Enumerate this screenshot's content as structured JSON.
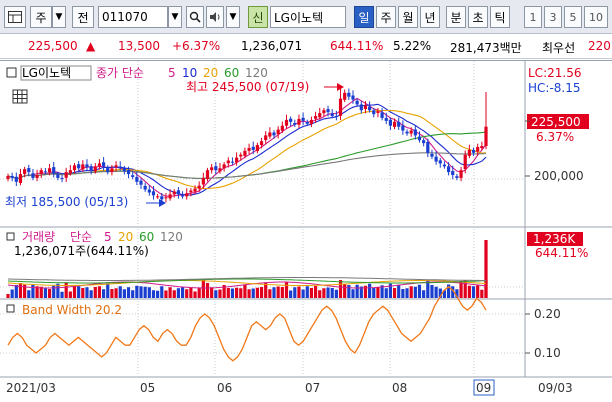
{
  "toolbar": {
    "mode_label": "주",
    "prev_label": "전",
    "code": "011070",
    "new_label": "신",
    "stock_name": "LG이노텍",
    "periods": [
      "일",
      "주",
      "월",
      "년",
      "분",
      "초",
      "틱"
    ],
    "active_period": "일",
    "intervals": [
      "1",
      "3",
      "5",
      "10"
    ]
  },
  "quote": {
    "price": "225,500",
    "change": "13,500",
    "change_pct": "+6.37%",
    "volume": "1,236,071",
    "vol_ratio": "644.11%",
    "turnover": "5.22%",
    "amount": "281,473백만",
    "best_ask_label": "최우선",
    "best_ask_value": "220"
  },
  "price_panel": {
    "name": "LG이노텍",
    "ma_label": "종가 단순",
    "ma_periods": [
      "5",
      "10",
      "20",
      "60",
      "120"
    ],
    "ma_colors": [
      "#d01c8b",
      "#1c2bd0",
      "#e8a300",
      "#2a9a2a",
      "#7a7a7a"
    ],
    "high_annotation": "최고 245,500 (07/19)",
    "low_annotation": "최저 185,500 (05/13)",
    "lc_label": "LC:21.56",
    "hc_label": "HC:-8.15",
    "price_badge": "225,500",
    "price_pct": "6.37%",
    "y_tick_label": "200,000"
  },
  "volume_panel": {
    "label": "거래량",
    "ma_label": "단순",
    "ma_periods": [
      "5",
      "20",
      "60",
      "120"
    ],
    "ma_colors": [
      "#d01c8b",
      "#e8a300",
      "#2a9a2a",
      "#7a7a7a"
    ],
    "detail": "1,236,071주(644.11%)",
    "badge": "1,236K",
    "badge_pct": "644.11%"
  },
  "bw_panel": {
    "label": "Band Width 20.2",
    "ticks": [
      "0.20",
      "0.10"
    ]
  },
  "x_axis": {
    "labels": [
      "2021/03",
      "05",
      "06",
      "07",
      "08",
      "09"
    ],
    "right_label": "09/03"
  },
  "colors": {
    "up": "#e1001e",
    "down": "#1a3fd0",
    "bandwidth": "#f07818",
    "highlight": "#2a5fc4"
  },
  "chart_data": {
    "type": "candlestick",
    "price_series": {
      "name": "LG이노텍",
      "x_labels": [
        "2021/03",
        "05",
        "06",
        "07",
        "08",
        "09"
      ],
      "close": [
        200000,
        199000,
        197000,
        201000,
        203500,
        202000,
        199000,
        200500,
        203000,
        202000,
        204000,
        201500,
        199000,
        198500,
        202000,
        203000,
        205500,
        204000,
        206000,
        204500,
        203000,
        205000,
        206500,
        205000,
        202000,
        204000,
        205500,
        204000,
        202500,
        201000,
        199500,
        197000,
        195500,
        193000,
        191500,
        190000,
        189500,
        188000,
        189000,
        190500,
        192000,
        190500,
        189500,
        191000,
        192500,
        193500,
        195000,
        199000,
        203000,
        204500,
        203000,
        204000,
        206000,
        208000,
        207000,
        209500,
        211000,
        213000,
        214500,
        213500,
        216000,
        218000,
        221000,
        222500,
        221000,
        224000,
        226000,
        229000,
        228000,
        226500,
        229500,
        228500,
        227000,
        229000,
        231000,
        232500,
        234000,
        233000,
        231000,
        230500,
        240000,
        243000,
        241000,
        239500,
        237000,
        234000,
        236500,
        234000,
        232000,
        233500,
        230000,
        228500,
        226000,
        228000,
        225500,
        223500,
        222000,
        223500,
        221000,
        218500,
        217000,
        212000,
        210000,
        207500,
        206500,
        205000,
        202000,
        200500,
        199000,
        203000,
        211000,
        213500,
        212000,
        215000,
        215500,
        225500
      ],
      "high_point": {
        "label": "최고 245,500 (07/19)",
        "value": 245500
      },
      "low_point": {
        "label": "최저 185,500 (05/13)",
        "value": 185500
      }
    },
    "volume_series": {
      "name": "거래량",
      "last_value": 1236071,
      "last_ratio": "644.11%"
    },
    "bandwidth_series": {
      "name": "Band Width 20.2",
      "values": [
        0.12,
        0.14,
        0.15,
        0.14,
        0.12,
        0.11,
        0.1,
        0.11,
        0.12,
        0.14,
        0.15,
        0.14,
        0.13,
        0.12,
        0.13,
        0.14,
        0.13,
        0.12,
        0.11,
        0.1,
        0.09,
        0.1,
        0.12,
        0.14,
        0.13,
        0.12,
        0.12,
        0.14,
        0.16,
        0.17,
        0.16,
        0.14,
        0.13,
        0.15,
        0.16,
        0.15,
        0.13,
        0.12,
        0.12,
        0.14,
        0.17,
        0.19,
        0.2,
        0.19,
        0.17,
        0.14,
        0.11,
        0.09,
        0.08,
        0.09,
        0.11,
        0.14,
        0.17,
        0.18,
        0.17,
        0.16,
        0.17,
        0.19,
        0.2,
        0.19,
        0.16,
        0.13,
        0.12,
        0.13,
        0.15,
        0.17,
        0.19,
        0.21,
        0.22,
        0.21,
        0.19,
        0.16,
        0.13,
        0.11,
        0.1,
        0.12,
        0.15,
        0.18,
        0.2,
        0.21,
        0.22,
        0.21,
        0.19,
        0.17,
        0.15,
        0.14,
        0.13,
        0.14,
        0.15,
        0.17,
        0.19,
        0.22,
        0.24,
        0.26,
        0.27,
        0.26,
        0.24,
        0.22,
        0.21,
        0.22,
        0.24,
        0.23,
        0.21
      ]
    },
    "y_ticks": {
      "price": [
        "200,000"
      ],
      "bandwidth": [
        "0.20",
        "0.10"
      ]
    }
  }
}
